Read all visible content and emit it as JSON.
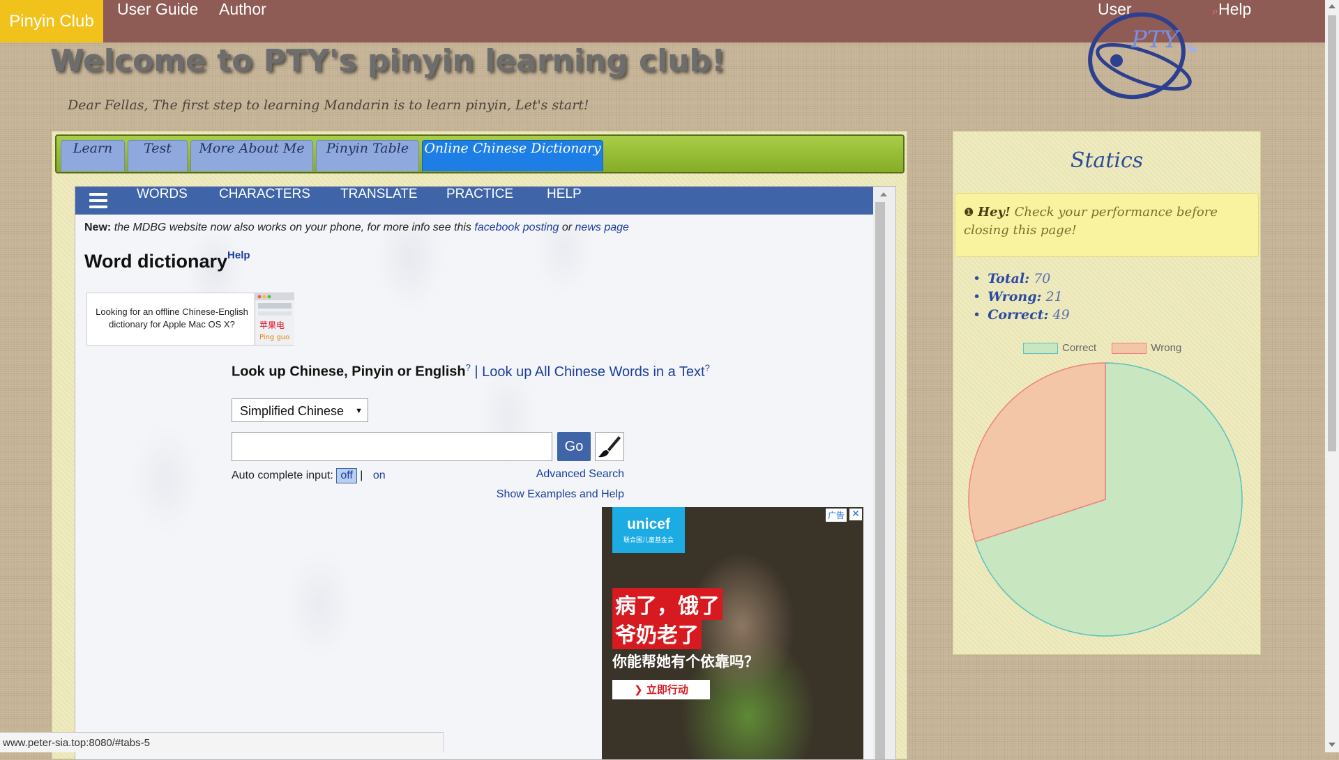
{
  "nav": {
    "brand": "Pinyin Club",
    "links": [
      "User Guide",
      "Author"
    ],
    "user": "User",
    "help": "Help"
  },
  "header": {
    "title": "Welcome to PTY's pinyin learning club!",
    "subtitle": "Dear Fellas, The first step to learning Mandarin is to learn pinyin, Let's start!",
    "logo_text": "PTY"
  },
  "tabs": [
    "Learn",
    "Test",
    "More About Me",
    "Pinyin Table",
    "Online Chinese Dictionary"
  ],
  "dictionary": {
    "nav_items": [
      "WORDS",
      "CHARACTERS",
      "TRANSLATE",
      "PRACTICE",
      "HELP"
    ],
    "news_label": "New:",
    "news_text": "the MDBG website now also works on your phone, for more info see this",
    "news_link1": "facebook posting",
    "news_or": "or",
    "news_link2": "news page",
    "title": "Word dictionary",
    "title_help": "Help",
    "mac_ad_line1": "Looking for an offline Chinese-English",
    "mac_ad_line2": "dictionary for Apple Mac OS X?",
    "lookup_label": "Look up Chinese, Pinyin or English",
    "lookup_q": "?",
    "lookup_sep": "|",
    "lookup_all": "Look up All Chinese Words in a Text",
    "select_value": "Simplified Chinese",
    "search_value": "",
    "go_label": "Go",
    "auto_label": "Auto complete input:",
    "auto_off": "off",
    "auto_sep": "|",
    "auto_on": "on",
    "advanced_search": "Advanced Search",
    "examples_help": "Show Examples and Help"
  },
  "ad": {
    "brand": "unicef",
    "brand_sub": "联合国儿童基金会",
    "tag": "广告",
    "close": "✕",
    "line1": "病了，饿了",
    "line2": "爷奶老了",
    "question": "你能帮她有个依靠吗？",
    "cta": "❯ 立即行动"
  },
  "status_url": "www.peter-sia.top:8080/#tabs-5",
  "stats": {
    "title": "Statics",
    "alert_bold": "Hey!",
    "alert_text": "Check your performance before closing this page!",
    "items": [
      {
        "label": "Total:",
        "value": "70"
      },
      {
        "label": "Wrong:",
        "value": "21"
      },
      {
        "label": "Correct:",
        "value": "49"
      }
    ]
  },
  "chart_data": {
    "type": "pie",
    "categories": [
      "Correct",
      "Wrong"
    ],
    "values": [
      49,
      21
    ],
    "colors": {
      "Correct": "#c8e6c0",
      "Wrong": "#f3c6a8",
      "Correct_border": "#5cc0c0",
      "Wrong_border": "#f08080"
    },
    "legend": "top"
  }
}
